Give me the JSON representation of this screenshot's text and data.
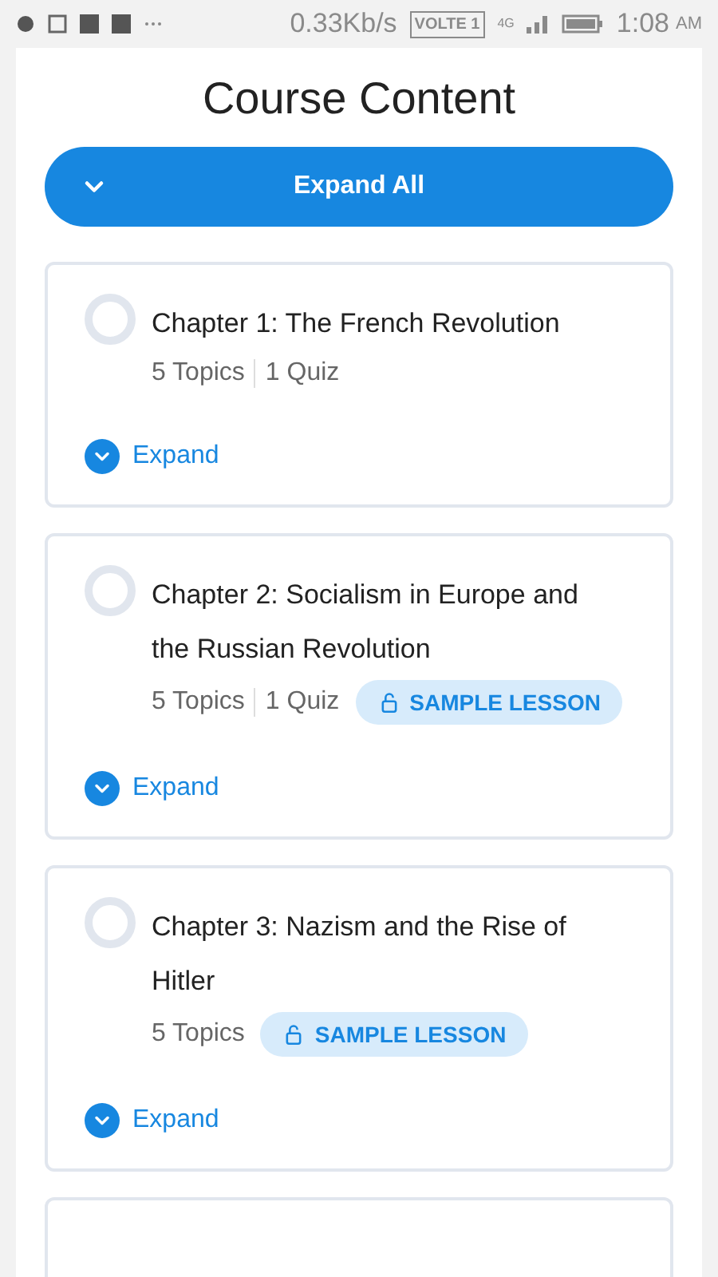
{
  "status_bar": {
    "speed": "0.33Kb/s",
    "volte": "VOLTE 1",
    "network": "4G",
    "time": "1:08",
    "ampm": "AM"
  },
  "title": "Course Content",
  "expand_all": {
    "label": "Expand All"
  },
  "chapters": [
    {
      "title": "Chapter 1: The French Revolution",
      "completed": false,
      "topics": "5 Topics",
      "quiz": "1 Quiz",
      "expand": "Expand"
    },
    {
      "title": "Chapter 2: Socialism in Europe and the Russian Revolution",
      "completed": false,
      "topics": "5 Topics",
      "quiz": "1 Quiz",
      "badge": "SAMPLE LESSON",
      "expand": "Expand"
    },
    {
      "title": "Chapter 3: Nazism and the Rise of Hitler",
      "completed": false,
      "topics": "5 Topics",
      "badge": "SAMPLE LESSON",
      "expand": "Expand"
    }
  ]
}
